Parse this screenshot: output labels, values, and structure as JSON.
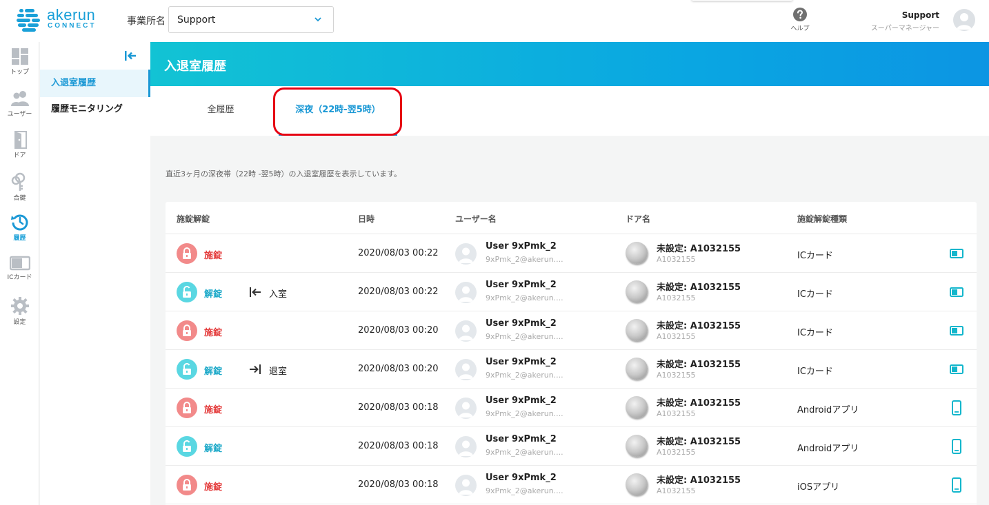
{
  "header": {
    "brand_word": "akerun",
    "brand_sub": "CONNECT",
    "office_label": "事業所名",
    "office_value": "Support",
    "help_label": "ヘルプ",
    "user_name": "Support",
    "user_role": "スーパーマネージャー"
  },
  "rail": {
    "items": [
      {
        "label": "トップ",
        "icon": "dashboard-icon"
      },
      {
        "label": "ユーザー",
        "icon": "users-icon"
      },
      {
        "label": "ドア",
        "icon": "door-icon"
      },
      {
        "label": "合鍵",
        "icon": "key-icon"
      },
      {
        "label": "履歴",
        "icon": "history-icon",
        "active": true
      },
      {
        "label": "ICカード",
        "icon": "ic-card-icon"
      },
      {
        "label": "設定",
        "icon": "gear-icon"
      }
    ]
  },
  "subnav": {
    "items": [
      {
        "label": "入退室履歴",
        "active": true
      },
      {
        "label": "履歴モニタリング"
      }
    ]
  },
  "page": {
    "title": "入退室履歴",
    "tabs": [
      {
        "label": "全履歴"
      },
      {
        "label": "深夜（22時-翌5時）",
        "active": true
      }
    ],
    "description": "直近3ヶ月の深夜帯（22時 -翌5時）の入退室履歴を表示しています。"
  },
  "table": {
    "headers": [
      "施錠解錠",
      "日時",
      "ユーザー名",
      "ドア名",
      "施錠解錠種類"
    ],
    "rows": [
      {
        "action": "施錠",
        "state": "locked",
        "direction": "",
        "direction_icon": "",
        "datetime": "2020/08/03 00:22",
        "user": "User 9xPmk_2",
        "email": "9xPmk_2@akerun....",
        "door": "未設定: A1032155",
        "door_id": "A1032155",
        "key_type": "ICカード",
        "key_icon": "ic-card-icon"
      },
      {
        "action": "解錠",
        "state": "unlocked",
        "direction": "入室",
        "direction_icon": "enter-icon",
        "datetime": "2020/08/03 00:22",
        "user": "User 9xPmk_2",
        "email": "9xPmk_2@akerun....",
        "door": "未設定: A1032155",
        "door_id": "A1032155",
        "key_type": "ICカード",
        "key_icon": "ic-card-icon"
      },
      {
        "action": "施錠",
        "state": "locked",
        "direction": "",
        "direction_icon": "",
        "datetime": "2020/08/03 00:20",
        "user": "User 9xPmk_2",
        "email": "9xPmk_2@akerun....",
        "door": "未設定: A1032155",
        "door_id": "A1032155",
        "key_type": "ICカード",
        "key_icon": "ic-card-icon"
      },
      {
        "action": "解錠",
        "state": "unlocked",
        "direction": "退室",
        "direction_icon": "exit-icon",
        "datetime": "2020/08/03 00:20",
        "user": "User 9xPmk_2",
        "email": "9xPmk_2@akerun....",
        "door": "未設定: A1032155",
        "door_id": "A1032155",
        "key_type": "ICカード",
        "key_icon": "ic-card-icon"
      },
      {
        "action": "施錠",
        "state": "locked",
        "direction": "",
        "direction_icon": "",
        "datetime": "2020/08/03 00:18",
        "user": "User 9xPmk_2",
        "email": "9xPmk_2@akerun....",
        "door": "未設定: A1032155",
        "door_id": "A1032155",
        "key_type": "Androidアプリ",
        "key_icon": "smartphone-icon"
      },
      {
        "action": "解錠",
        "state": "unlocked",
        "direction": "",
        "direction_icon": "",
        "datetime": "2020/08/03 00:18",
        "user": "User 9xPmk_2",
        "email": "9xPmk_2@akerun....",
        "door": "未設定: A1032155",
        "door_id": "A1032155",
        "key_type": "Androidアプリ",
        "key_icon": "smartphone-icon"
      },
      {
        "action": "施錠",
        "state": "locked",
        "direction": "",
        "direction_icon": "",
        "datetime": "2020/08/03 00:18",
        "user": "User 9xPmk_2",
        "email": "9xPmk_2@akerun....",
        "door": "未設定: A1032155",
        "door_id": "A1032155",
        "key_type": "iOSアプリ",
        "key_icon": "smartphone-icon"
      }
    ]
  },
  "colors": {
    "accent": "#1a98d5",
    "locked": "#e43b3b",
    "unlocked": "#1aa8c8",
    "annotation_ring": "#e60012"
  }
}
